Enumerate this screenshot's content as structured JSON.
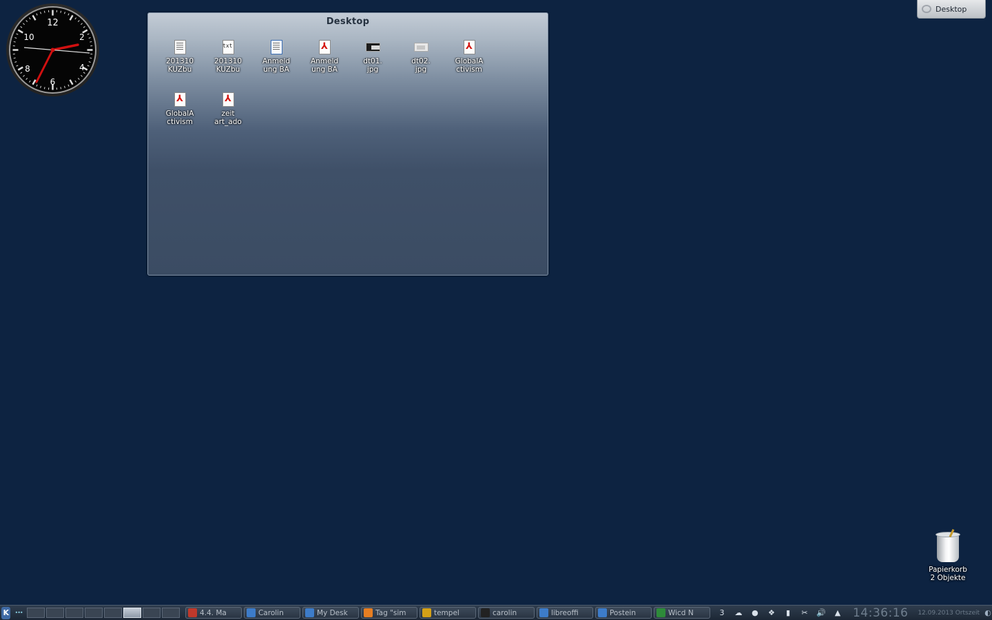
{
  "clock_widget": {
    "numerals": [
      "12",
      "2",
      "4",
      "6",
      "8",
      "10"
    ],
    "time": "14:36:16"
  },
  "folder_view": {
    "title": "Desktop",
    "items": [
      {
        "line1": "201310",
        "line2": "KUZbu",
        "icon": "document-icon"
      },
      {
        "line1": "201310",
        "line2": "KUZbu",
        "icon": "text-file-icon",
        "badge": "txt"
      },
      {
        "line1": "Anmeld",
        "line2": "ung BA",
        "icon": "document-icon"
      },
      {
        "line1": "Anmeld",
        "line2": "ung BA",
        "icon": "pdf-icon"
      },
      {
        "line1": "dt01.",
        "line2": "jpg",
        "icon": "image-icon"
      },
      {
        "line1": "dt02.",
        "line2": "jpg",
        "icon": "image-icon"
      },
      {
        "line1": "GlobalA",
        "line2": "ctivism",
        "icon": "pdf-icon"
      },
      {
        "line1": "GlobalA",
        "line2": "ctivism",
        "icon": "pdf-icon"
      },
      {
        "line1": "zeit",
        "line2": "art_ado",
        "icon": "pdf-icon"
      }
    ]
  },
  "toolbox": {
    "label": "Desktop"
  },
  "trash": {
    "name": "Papierkorb",
    "count": "2 Objekte"
  },
  "panel": {
    "launcher_label": "K",
    "tasks": [
      {
        "label": "4.4. Ma",
        "icon_color": "#c0392b"
      },
      {
        "label": "Carolin",
        "icon_color": "#3d7cc9"
      },
      {
        "label": "My Desk",
        "icon_color": "#3d7cc9"
      },
      {
        "label": "Tag \"sim",
        "icon_color": "#e67e22"
      },
      {
        "label": "tempel",
        "icon_color": "#d4a017"
      },
      {
        "label": "carolin",
        "icon_color": "#222222"
      },
      {
        "label": "libreoffi",
        "icon_color": "#3d7cc9"
      },
      {
        "label": "Postein",
        "icon_color": "#3d7cc9"
      },
      {
        "label": "Wicd N",
        "icon_color": "#2e8b3a"
      }
    ],
    "tray": [
      {
        "name": "updates-icon",
        "glyph": "3"
      },
      {
        "name": "network-icon",
        "glyph": "☁"
      },
      {
        "name": "recording-icon",
        "glyph": "●"
      },
      {
        "name": "dropbox-icon",
        "glyph": "❖"
      },
      {
        "name": "battery-icon",
        "glyph": "▮"
      },
      {
        "name": "scissors-icon",
        "glyph": "✂"
      },
      {
        "name": "volume-icon",
        "glyph": "🔊"
      },
      {
        "name": "expand-tray-icon",
        "glyph": "▲"
      }
    ],
    "clock": "14:36:16",
    "date": "12.09.2013 Ortszeit"
  }
}
